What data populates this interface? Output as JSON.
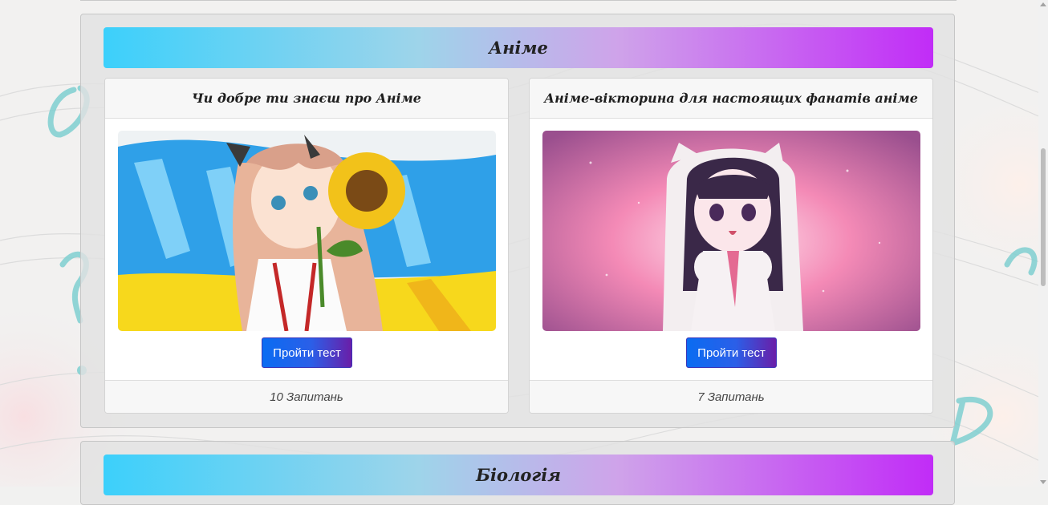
{
  "categories": [
    {
      "title": "Аніме",
      "quizzes": [
        {
          "title": "Чи добре ти знаєш про Аніме",
          "button_label": "Пройти тест",
          "question_count": "10 Запитань",
          "image": "anime-girl-sunflower-ukrainian-flag"
        },
        {
          "title": "Аніме-вікторина для настоящих фанатів аніме",
          "button_label": "Пройти тест",
          "question_count": "7 Запитань",
          "image": "anime-girl-hoodie-pink-background"
        }
      ]
    },
    {
      "title": "Біологія"
    }
  ],
  "colors": {
    "header_gradient_start": "#3cd0fb",
    "header_gradient_end": "#c12cf7",
    "button_start": "#0a6cf2",
    "button_end": "#6a1ea8"
  }
}
